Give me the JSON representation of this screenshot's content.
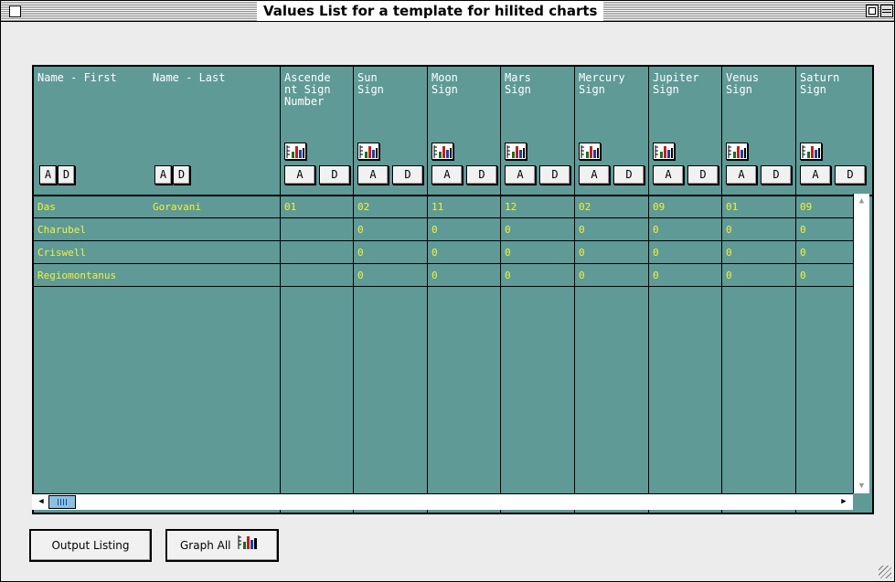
{
  "window": {
    "title": "Values List for a template for hilited charts"
  },
  "columns": [
    {
      "header": "Name - First"
    },
    {
      "header": "Name - Last"
    },
    {
      "header": "Ascende\nnt Sign\nNumber"
    },
    {
      "header": "Sun\nSign"
    },
    {
      "header": "Moon\nSign"
    },
    {
      "header": "Mars\nSign"
    },
    {
      "header": "Mercury\nSign"
    },
    {
      "header": "Jupiter\nSign"
    },
    {
      "header": "Venus\nSign"
    },
    {
      "header": "Saturn\nSign"
    }
  ],
  "sort_buttons": {
    "asc_label": "A",
    "desc_label": "D"
  },
  "rows": [
    {
      "cells": [
        "Das",
        "Goravani",
        "01",
        "02",
        "11",
        "12",
        "02",
        "09",
        "01",
        "09"
      ]
    },
    {
      "cells": [
        "Charubel",
        "",
        "",
        "0",
        "0",
        "0",
        "0",
        "0",
        "0",
        "0"
      ]
    },
    {
      "cells": [
        "Criswell",
        "",
        "",
        "0",
        "0",
        "0",
        "0",
        "0",
        "0",
        "0"
      ]
    },
    {
      "cells": [
        "Regiomontanus",
        "",
        "",
        "0",
        "0",
        "0",
        "0",
        "0",
        "0",
        "0"
      ]
    }
  ],
  "footer": {
    "output_listing_label": "Output Listing",
    "graph_all_label": "Graph All"
  },
  "icons": {
    "chart": "bar-chart-icon",
    "close": "close-box-icon",
    "zoom": "zoom-box-icon",
    "collapse": "collapse-box-icon"
  },
  "colors": {
    "grid_bg": "#5f9a97",
    "cell_text": "#f3f335",
    "header_text": "#ffffff"
  }
}
